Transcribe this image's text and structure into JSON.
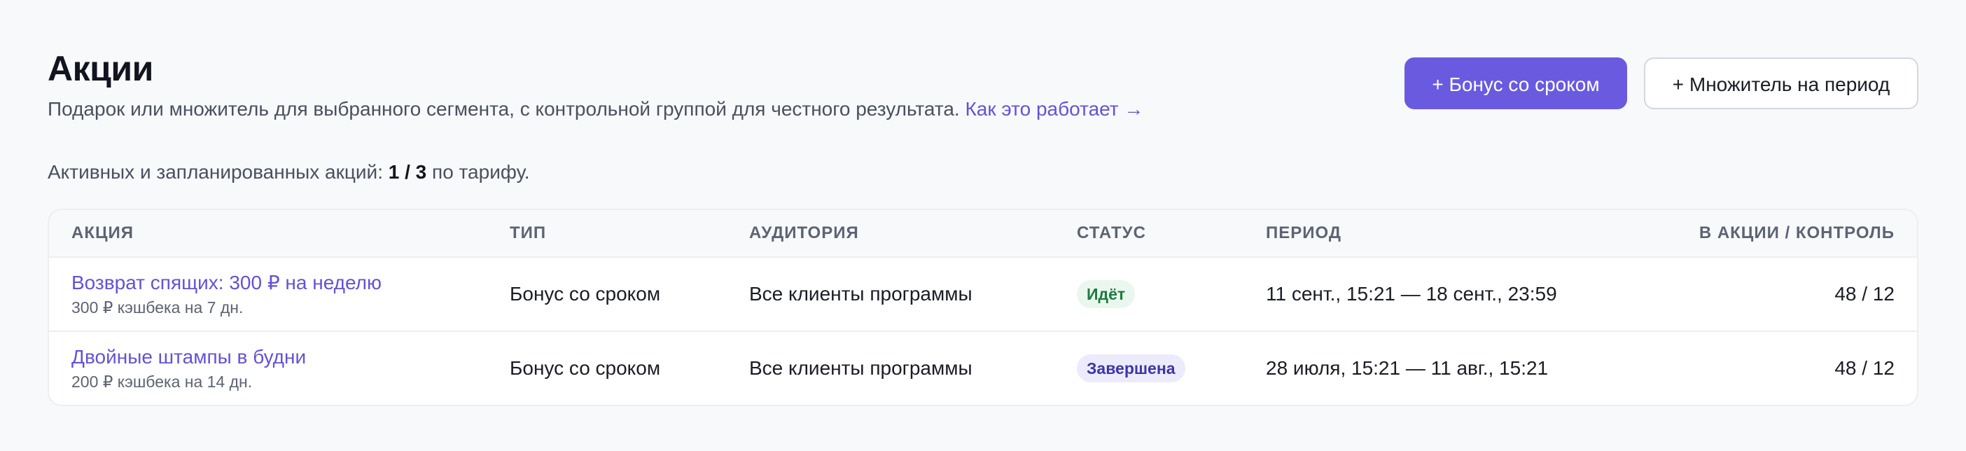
{
  "header": {
    "title": "Акции",
    "subtitle": "Подарок или множитель для выбранного сегмента, с контрольной группой для честного результата.",
    "help_link": "Как это работает →"
  },
  "actions": {
    "bonus_button": "+ Бонус со сроком",
    "multiplier_button": "+ Множитель на период"
  },
  "quota": {
    "prefix": "Активных и запланированных акций:",
    "value": "1 / 3",
    "suffix": "по тарифу."
  },
  "table": {
    "columns": [
      "АКЦИЯ",
      "ТИП",
      "АУДИТОРИЯ",
      "СТАТУС",
      "ПЕРИОД",
      "В АКЦИИ / КОНТРОЛЬ"
    ],
    "rows": [
      {
        "name": "Возврат спящих: 300 ₽ на неделю",
        "desc": "300 ₽ кэшбека на 7 дн.",
        "type": "Бонус со сроком",
        "audience": "Все клиенты программы",
        "status": "Идёт",
        "period": "11 сент., 15:21 — 18 сент., 23:59",
        "counts": "48 / 12"
      },
      {
        "name": "Двойные штампы в будни",
        "desc": "200 ₽ кэшбека на 14 дн.",
        "type": "Бонус со сроком",
        "audience": "Все клиенты программы",
        "status": "Завершена",
        "period": "28 июля, 15:21 — 11 авг., 15:21",
        "counts": "48 / 12"
      }
    ]
  },
  "colors": {
    "accent": "#6a5ae0",
    "link": "#6452d9",
    "status_active_bg": "#e9f7ee",
    "status_active_text": "#1f7a3e",
    "status_done_bg": "#ecebfb",
    "status_done_text": "#3f35a8"
  }
}
